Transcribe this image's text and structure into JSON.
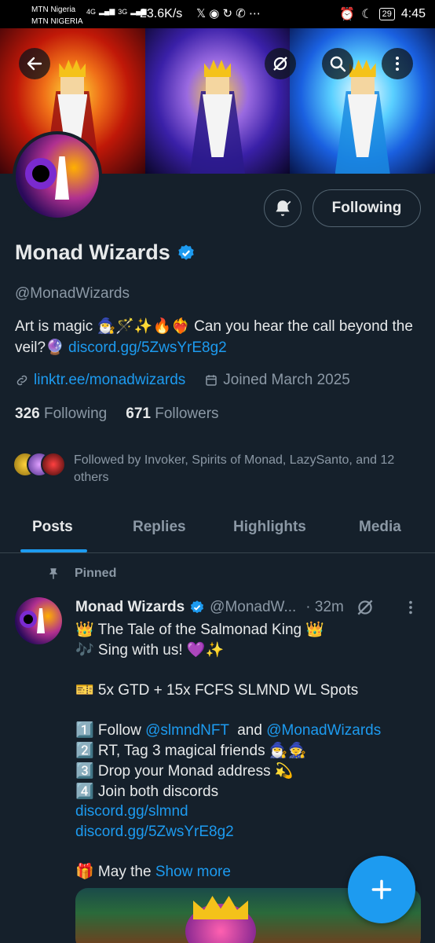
{
  "status_bar": {
    "carrier_1": "MTN Nigeria",
    "carrier_2": "MTN NIGERIA",
    "net_1": "4G",
    "net_2": "3G",
    "speed": "23.6K/s",
    "app_icons": "𝕏 ◉ ↻ ✆ ⋯",
    "battery": "29",
    "time": "4:45"
  },
  "profile": {
    "display_name": "Monad Wizards",
    "handle": "@MonadWizards",
    "bio_text": "Art is magic 🧙‍♂️🪄✨🔥❤️‍🔥  Can you hear the call beyond the veil?🔮 ",
    "bio_link": "discord.gg/5ZwsYrE8g2",
    "website": "linktr.ee/monadwizards",
    "joined": "Joined March 2025",
    "following_count": "326",
    "following_label": "Following",
    "followers_count": "671",
    "followers_label": "Followers",
    "followed_by": "Followed by Invoker, Spirits of Monad, LazySanto, and 12 others",
    "follow_button_label": "Following"
  },
  "tabs": [
    "Posts",
    "Replies",
    "Highlights",
    "Media"
  ],
  "tweet": {
    "pinned_label": "Pinned",
    "name": "Monad Wizards",
    "handle": "@MonadW...",
    "time": "· 32m",
    "lines": {
      "l1": "👑 The Tale of the Salmonad King 👑",
      "l2": "🎶 Sing with us! 💜✨",
      "l3": "🎫 5x GTD + 15x FCFS SLMND WL Spots",
      "l4_pre": "1️⃣ Follow ",
      "l4_m1": "@slmndNFT",
      "l4_mid": "  and ",
      "l4_m2": "@MonadWizards",
      "l5": "2️⃣ RT, Tag 3 magical friends 🧙‍♂️🧙",
      "l6": "3️⃣ Drop your Monad address 💫",
      "l7": "4️⃣ Join both discords",
      "l8": "discord.gg/slmnd",
      "l9": "discord.gg/5ZwsYrE8g2",
      "l10_pre": "🎁 May the ",
      "l10_more": "Show more"
    }
  },
  "colors": {
    "background": "#15202b",
    "accent": "#1d9bf0",
    "secondary_text": "#8b98a5",
    "primary_text": "#e7e9ea"
  },
  "icons": [
    "back-arrow-icon",
    "grok-icon",
    "search-icon",
    "more-vertical-icon",
    "bell-icon",
    "verified-badge-icon",
    "link-icon",
    "calendar-icon",
    "pin-icon",
    "plus-icon"
  ]
}
